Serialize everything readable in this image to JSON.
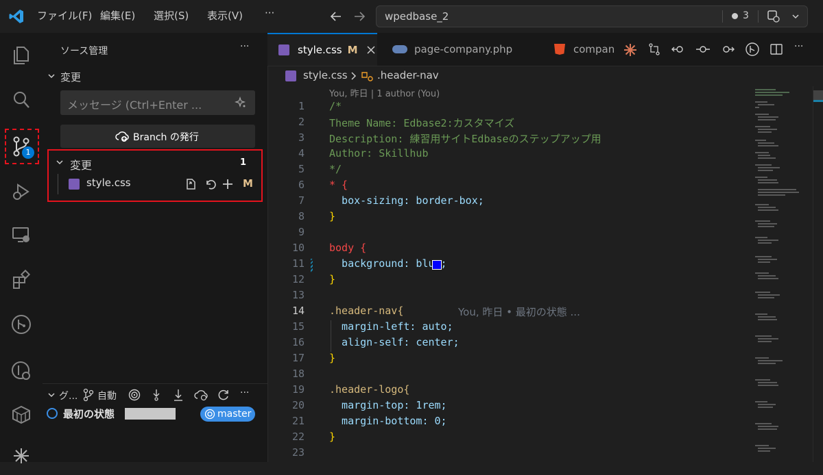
{
  "titlebar": {
    "menus": [
      "ファイル(F)",
      "編集(E)",
      "選択(S)",
      "表示(V)",
      "···"
    ],
    "search_text": "wpedbase_2",
    "notification_count": "3"
  },
  "activity": {
    "scm_badge": "1"
  },
  "sidebar": {
    "title": "ソース管理",
    "more": "···",
    "changes_header": "変更",
    "message_placeholder": "メッセージ (Ctrl+Enter ...",
    "publish_label": "Branch の発行",
    "changes_group_label": "変更",
    "changes_count": "1",
    "file_name": "style.css",
    "file_status": "M",
    "graph_header": "グ...",
    "graph_auto": "自動",
    "graph_more": "···",
    "commit_message": "最初の状態",
    "branch_badge": "master"
  },
  "editor": {
    "tabs": [
      {
        "label": "style.css",
        "status": "M"
      },
      {
        "label": "page-company.php"
      },
      {
        "label": "compan"
      }
    ],
    "breadcrumb_file": "style.css",
    "breadcrumb_symbol": ".header-nav",
    "blame": "You, 昨日 | 1 author (You)",
    "inline_blame": "You, 昨日 • 最初の状態 ...",
    "lines": [
      {
        "n": "1",
        "t": "/*"
      },
      {
        "n": "2",
        "t": "Theme Name: Edbase2:カスタマイズ"
      },
      {
        "n": "3",
        "t": "Description: 練習用サイトEdbaseのステップアップ用"
      },
      {
        "n": "4",
        "t": "Author: Skillhub"
      },
      {
        "n": "5",
        "t": "*/"
      },
      {
        "n": "6",
        "t": "* {"
      },
      {
        "n": "7",
        "t": "  box-sizing: border-box;"
      },
      {
        "n": "8",
        "t": "}"
      },
      {
        "n": "9",
        "t": ""
      },
      {
        "n": "10",
        "t": "body {"
      },
      {
        "n": "11",
        "t": "  background: blue;"
      },
      {
        "n": "12",
        "t": "}"
      },
      {
        "n": "13",
        "t": ""
      },
      {
        "n": "14",
        "t": ".header-nav{"
      },
      {
        "n": "15",
        "t": "  margin-left: auto;"
      },
      {
        "n": "16",
        "t": "  align-self: center;"
      },
      {
        "n": "17",
        "t": "}"
      },
      {
        "n": "18",
        "t": ""
      },
      {
        "n": "19",
        "t": ".header-logo{"
      },
      {
        "n": "20",
        "t": "  margin-top: 1rem;"
      },
      {
        "n": "21",
        "t": "  margin-bottom: 0;"
      },
      {
        "n": "22",
        "t": "}"
      },
      {
        "n": "23",
        "t": ""
      }
    ]
  },
  "colors": {
    "accent": "#0078d4",
    "highlight_red": "#e5131d",
    "badge_blue": "#3a8ee6",
    "swatch_blue": "#0000ff"
  }
}
